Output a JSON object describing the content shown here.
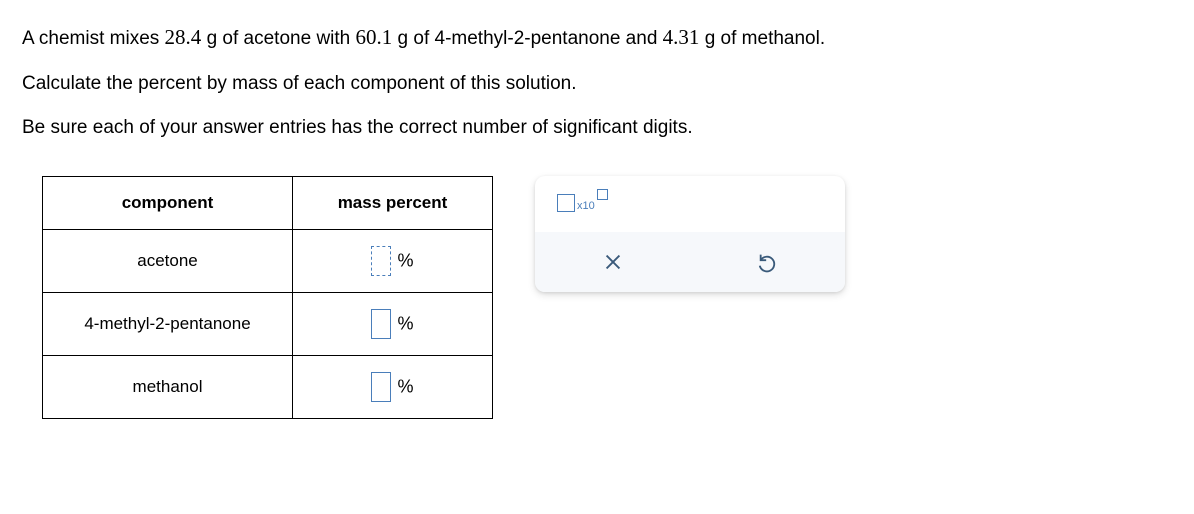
{
  "question": {
    "line1_parts": [
      "A chemist mixes ",
      "28.4",
      " g of acetone with ",
      "60.1",
      " g of 4-methyl-2-pentanone and ",
      "4.31",
      " g of methanol."
    ],
    "line2": "Calculate the percent by mass of each component of this solution.",
    "line3": "Be sure each of your answer entries has the correct number of significant digits."
  },
  "table": {
    "headers": {
      "col1": "component",
      "col2": "mass percent"
    },
    "rows": [
      {
        "component": "acetone",
        "unit": "%"
      },
      {
        "component": "4-methyl-2-pentanone",
        "unit": "%"
      },
      {
        "component": "methanol",
        "unit": "%"
      }
    ]
  },
  "tools": {
    "sci_label": "x10"
  }
}
